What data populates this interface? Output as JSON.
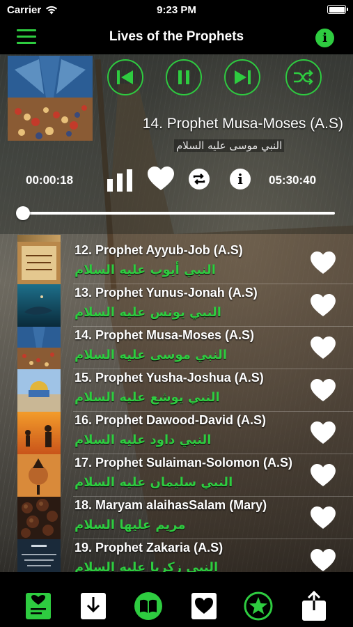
{
  "status_bar": {
    "carrier": "Carrier",
    "time": "9:23 PM"
  },
  "nav": {
    "title": "Lives of the Prophets",
    "menu_icon": "hamburger-menu-icon",
    "info_icon": "info-icon"
  },
  "player": {
    "track_title": "14. Prophet Musa-Moses (A.S)",
    "track_arabic": "النبي موسى عليه السلام",
    "elapsed": "00:00:18",
    "duration": "05:30:40",
    "progress": 0.001,
    "controls": [
      "previous-icon",
      "pause-icon",
      "next-icon",
      "shuffle-icon"
    ]
  },
  "tracks": [
    {
      "title": "12. Prophet Ayyub-Job (A.S)",
      "arabic": "النبي أيوب عليه السلام"
    },
    {
      "title": "13. Prophet Yunus-Jonah (A.S)",
      "arabic": "النبي يونس عليه السلام"
    },
    {
      "title": "14. Prophet Musa-Moses (A.S)",
      "arabic": "النبي موسى عليه السلام"
    },
    {
      "title": "15. Prophet Yusha-Joshua (A.S)",
      "arabic": "النبي يوشع عليه السلام"
    },
    {
      "title": "16. Prophet Dawood-David (A.S)",
      "arabic": "النبي داود عليه السلام"
    },
    {
      "title": "17. Prophet Sulaiman-Solomon (A.S)",
      "arabic": "النبي سليمان عليه السلام"
    },
    {
      "title": "18. Maryam alaihasSalam (Mary)",
      "arabic": "مريم عليها السلام"
    },
    {
      "title": "19. Prophet Zakaria (A.S)",
      "arabic": "النبي زكريا عليه السلام"
    }
  ],
  "tabs": [
    "playlist-tab-icon",
    "download-tab-icon",
    "book-tab-icon",
    "favorites-tab-icon",
    "star-tab-icon",
    "share-tab-icon"
  ],
  "colors": {
    "accent": "#2ecc40",
    "bar_background": "#000000"
  }
}
